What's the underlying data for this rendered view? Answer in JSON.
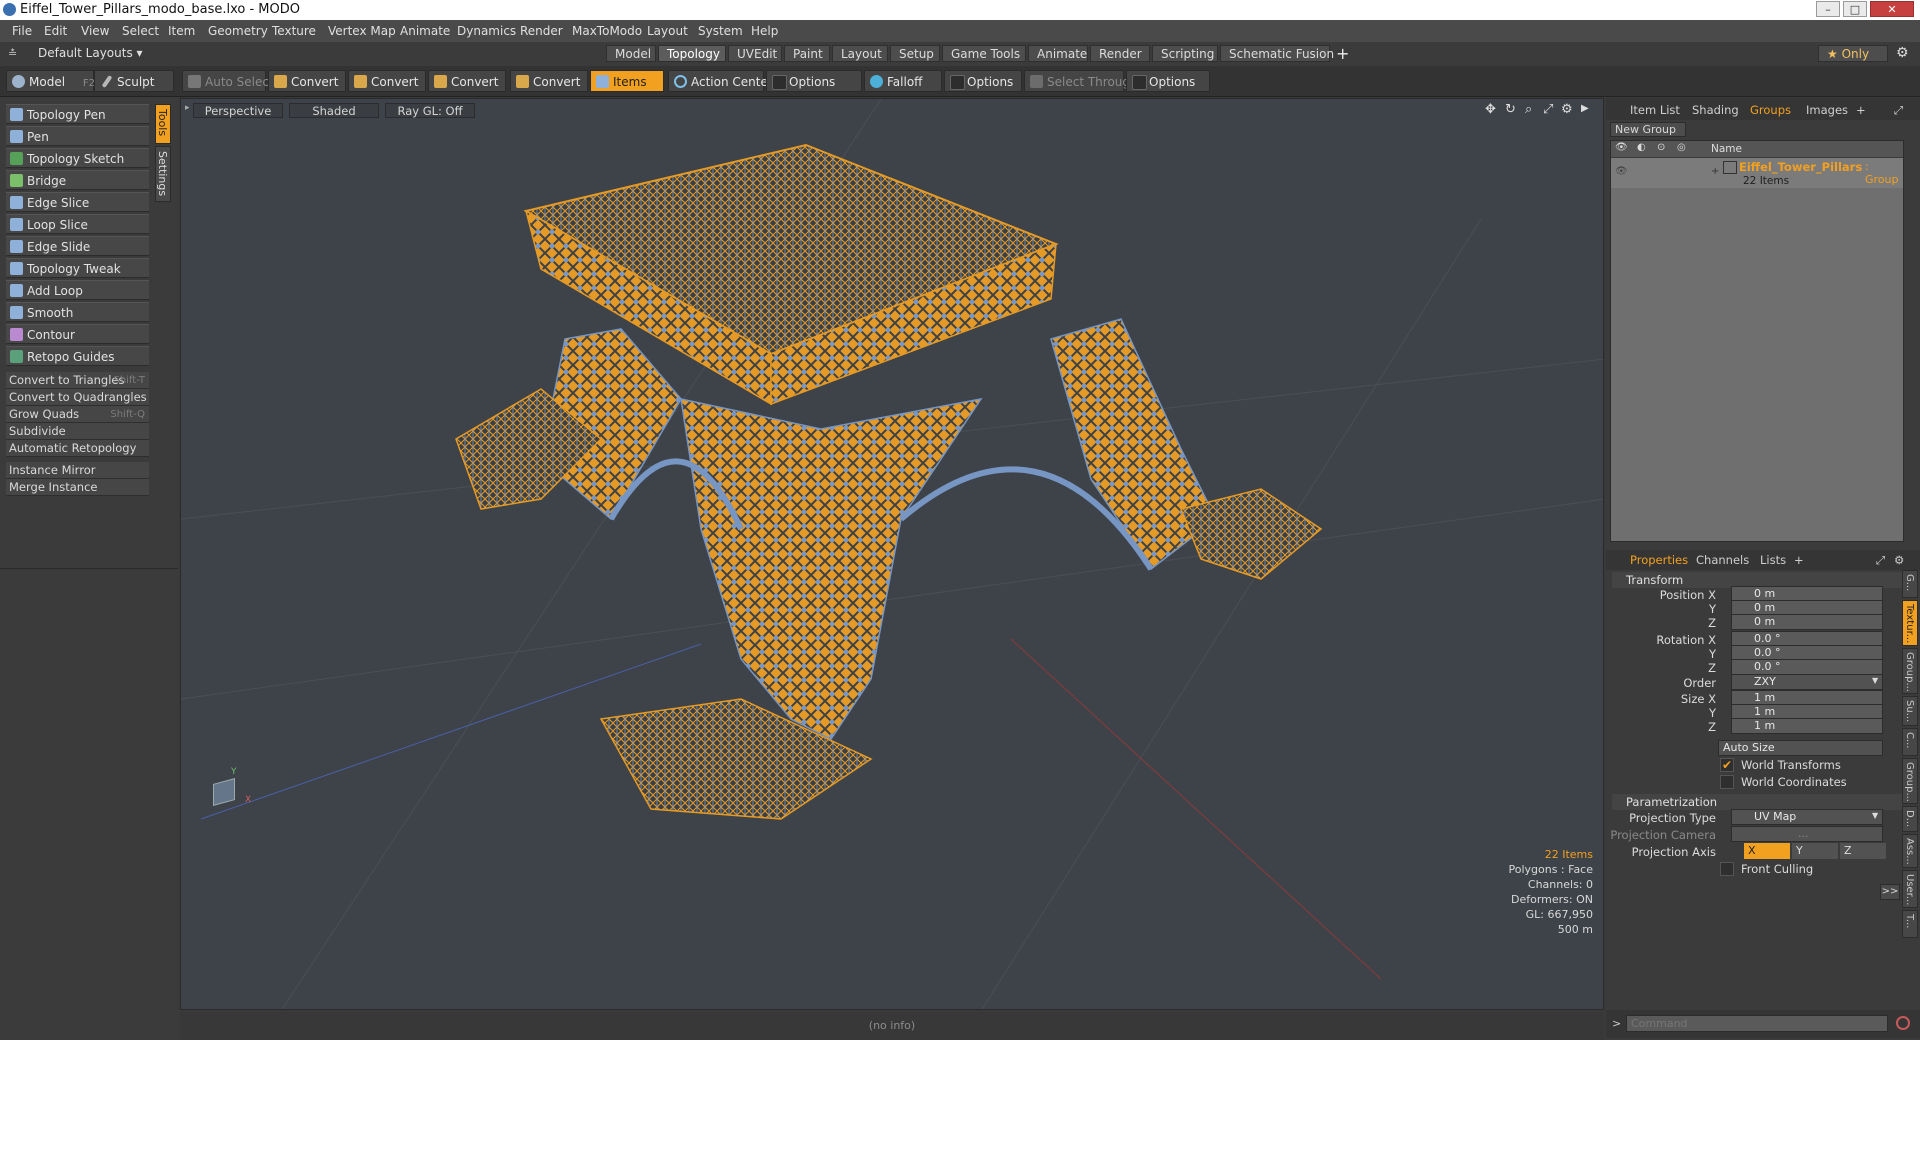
{
  "window": {
    "title": "Eiffel_Tower_Pillars_modo_base.lxo - MODO",
    "controls": [
      "–",
      "□",
      "✕"
    ]
  },
  "menu": [
    "File",
    "Edit",
    "View",
    "Select",
    "Item",
    "Geometry",
    "Texture",
    "Vertex Map",
    "Animate",
    "Dynamics",
    "Render",
    "MaxToModo",
    "Layout",
    "System",
    "Help"
  ],
  "layout_bar": {
    "preset": "Default Layouts ▾",
    "tabs": [
      "Model",
      "Topology",
      "UVEdit",
      "Paint",
      "Layout",
      "Setup",
      "Game Tools",
      "Animate",
      "Render",
      "Scripting",
      "Schematic Fusion"
    ],
    "active_tab": "Topology",
    "add": "+",
    "only": "★ Only",
    "gear": "⚙"
  },
  "toolbar": {
    "model": "Model",
    "model_key": "F2",
    "sculpt": "Sculpt",
    "auto_select": "Auto Select",
    "convert": "Convert",
    "items": "Items",
    "action_center": "Action Center",
    "options": "Options",
    "falloff": "Falloff",
    "select_through": "Select Through"
  },
  "left_panel": {
    "tools": [
      "Topology Pen",
      "Pen",
      "Topology Sketch",
      "Bridge",
      "Edge Slice",
      "Loop Slice",
      "Edge Slide",
      "Topology Tweak",
      "Add Loop",
      "Smooth",
      "Contour",
      "Retopo Guides"
    ],
    "commands": [
      {
        "label": "Convert to Triangles",
        "shortcut": "Shift-T"
      },
      {
        "label": "Convert to Quadrangles",
        "shortcut": ""
      },
      {
        "label": "Grow Quads",
        "shortcut": "Shift-Q"
      },
      {
        "label": "Subdivide",
        "shortcut": ""
      },
      {
        "label": "Automatic Retopology",
        "shortcut": ""
      }
    ],
    "instance_commands": [
      "Instance Mirror",
      "Merge Instance"
    ],
    "vertical_tabs": [
      "Tools",
      "Settings"
    ]
  },
  "viewport": {
    "view": "Perspective",
    "shading": "Shaded",
    "raygl": "Ray GL: Off",
    "info": {
      "items": "22 Items",
      "polygons": "Polygons : Face",
      "channels": "Channels: 0",
      "deformers": "Deformers: ON",
      "gl": "GL: 667,950",
      "scale": "500 m"
    },
    "axis_y": "Y",
    "axis_x": "X",
    "status": "(no info)"
  },
  "groups_panel": {
    "tabs": [
      "Item List",
      "Shading",
      "Groups",
      "Images"
    ],
    "active_tab": "Groups",
    "new_group": "New Group",
    "col_name": "Name",
    "group_name": "Eiffel_Tower_Pillars",
    "group_type": ": Group",
    "group_count": "22 Items"
  },
  "properties_panel": {
    "tabs": [
      "Properties",
      "Channels",
      "Lists"
    ],
    "active_tab": "Properties",
    "transform_section": "Transform",
    "position_label": "Position X",
    "rotation_label": "Rotation X",
    "size_label": "Size X",
    "y_label": "Y",
    "z_label": "Z",
    "order_label": "Order",
    "position": [
      "0 m",
      "0 m",
      "0 m"
    ],
    "rotation": [
      "0.0 °",
      "0.0 °",
      "0.0 °"
    ],
    "order": "ZXY",
    "size": [
      "1 m",
      "1 m",
      "1 m"
    ],
    "auto_size": "Auto Size",
    "world_transforms": "World Transforms",
    "world_coordinates": "World Coordinates",
    "param_section": "Parametrization",
    "projection_type_label": "Projection Type",
    "projection_type": "UV Map",
    "projection_camera_label": "Projection Camera",
    "projection_camera": "...",
    "projection_axis_label": "Projection Axis",
    "axes": [
      "X",
      "Y",
      "Z"
    ],
    "front_culling": "Front Culling",
    "more": ">>",
    "side_tabs": [
      "G...",
      "Textur...",
      "Group...",
      "Su...",
      "C...",
      "Group...",
      "D...",
      "Ass...",
      "User...",
      "T..."
    ]
  },
  "command_bar": {
    "prompt": ">",
    "placeholder": "Command"
  },
  "colors": {
    "accent": "#f2a020",
    "wire": "#e59a26",
    "mesh_blue": "#7796c4",
    "bg": "#3a3a3a"
  }
}
